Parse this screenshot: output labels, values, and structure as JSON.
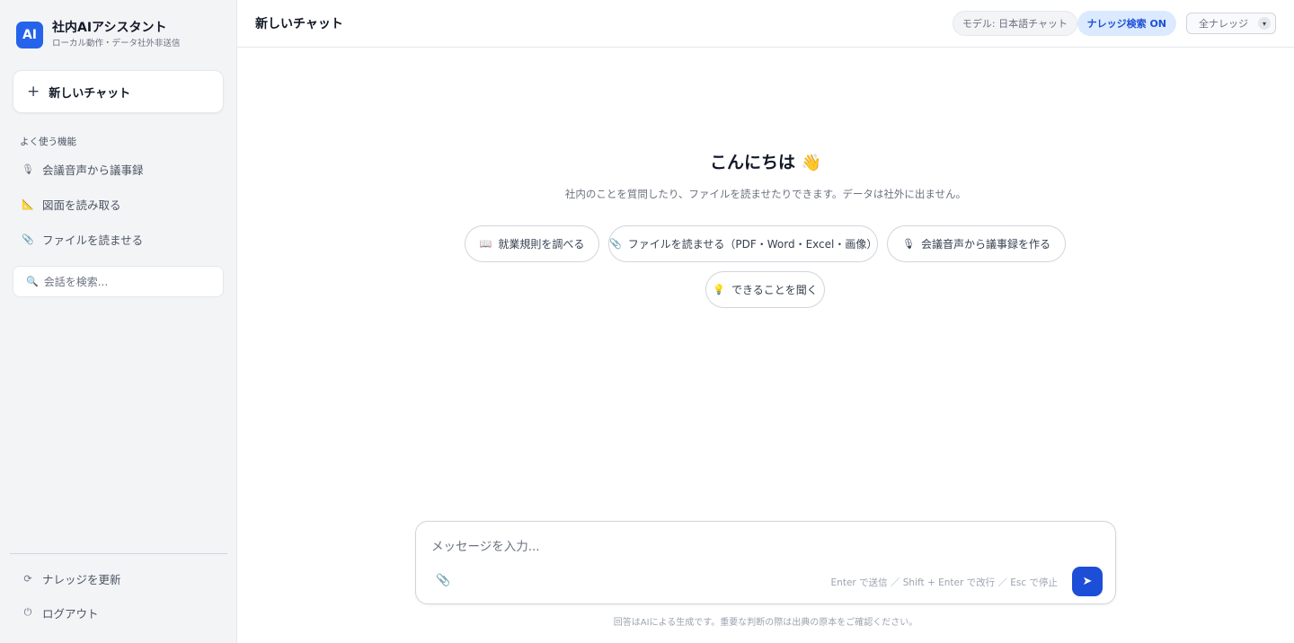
{
  "sidebar": {
    "logo_text": "AI",
    "app_title": "社内AIアシスタント",
    "app_subtitle": "ローカル動作・データ社外非送信",
    "new_chat_icon": "+",
    "new_chat_label": "新しいチャット",
    "section_label": "よく使う機能",
    "features": [
      {
        "icon": "microphone-icon",
        "glyph": "🎙",
        "label": "会議音声から議事録"
      },
      {
        "icon": "ruler-triangle-icon",
        "glyph": "📐",
        "label": "図面を読み取る"
      },
      {
        "icon": "paperclip-icon",
        "glyph": "📎",
        "label": "ファイルを読ませる"
      }
    ],
    "search": {
      "icon": "search-icon",
      "glyph": "🔍",
      "placeholder": "会話を検索..."
    },
    "bottom": [
      {
        "icon": "refresh-icon",
        "glyph": "⟳",
        "label": "ナレッジを更新"
      },
      {
        "icon": "power-icon",
        "glyph": "⏻",
        "label": "ログアウト"
      }
    ]
  },
  "header": {
    "title": "新しいチャット",
    "model_pill": "モデル: 日本語チャット",
    "knowledge_toggle": "ナレッジ検索 ON",
    "knowledge_select": "全ナレッジ"
  },
  "hero": {
    "greeting": "こんにちは",
    "greeting_emoji": "👋",
    "subtitle": "社内のことを質問したり、ファイルを読ませたりできます。データは社外に出ません。"
  },
  "suggestions": [
    {
      "icon": "book-icon",
      "glyph": "📖",
      "label": "就業規則を調べる"
    },
    {
      "icon": "paperclip-icon",
      "glyph": "📎",
      "label": "ファイルを読ませる（PDF・Word・Excel・画像）"
    },
    {
      "icon": "microphone-icon",
      "glyph": "🎙",
      "label": "会議音声から議事録を作る"
    },
    {
      "icon": "lightbulb-icon",
      "glyph": "💡",
      "label": "できることを聞く"
    }
  ],
  "composer": {
    "placeholder": "メッセージを入力...",
    "attach_glyph": "📎",
    "hint": "Enter で送信 ／ Shift + Enter で改行 ／ Esc で停止",
    "send_glyph": "➤"
  },
  "footer": {
    "disclaimer": "回答はAIによる生成です。重要な判断の際は出典の原本をご確認ください。"
  },
  "colors": {
    "accent": "#2563eb",
    "send_button": "#1d4ed8",
    "knowledge_pill_bg": "#dbeafe",
    "sidebar_bg": "#f3f4f6"
  }
}
